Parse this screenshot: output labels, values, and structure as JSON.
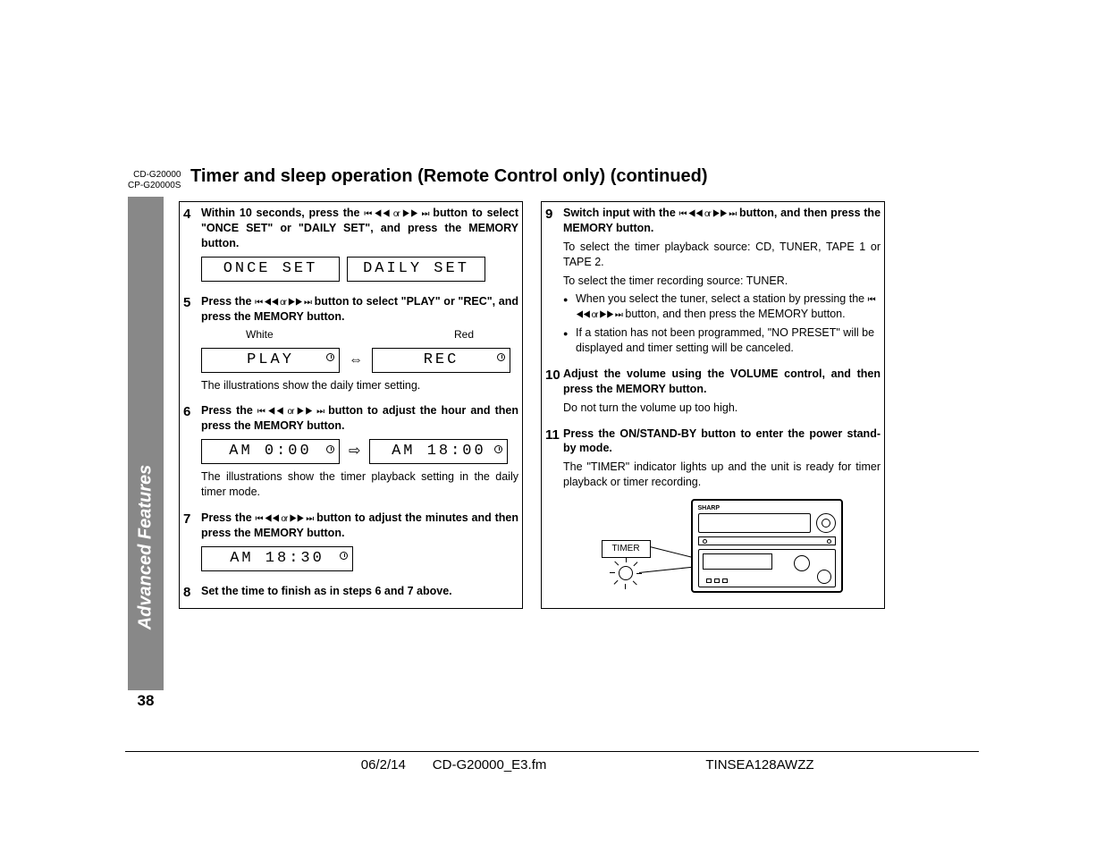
{
  "header": {
    "model1": "CD-G20000",
    "model2": "CP-G20000S",
    "title": "Timer and sleep operation (Remote Control only) (continued)"
  },
  "sidebar": {
    "section_label": "Advanced Features",
    "page_number": "38"
  },
  "icons": {
    "skip": "⏮ ◀◀ or ▶▶ ⏭"
  },
  "left_steps": {
    "s4": {
      "num": "4",
      "instruction_a": "Within 10 seconds, press the ",
      "instruction_b": " button to select \"ONCE SET\" or \"DAILY SET\", and press the MEMORY button.",
      "lcd1": "ONCE  SET",
      "lcd2": "DAILY SET"
    },
    "s5": {
      "num": "5",
      "instruction_a": "Press the ",
      "instruction_b": " button to select \"PLAY\" or \"REC\", and press the MEMORY button.",
      "label_white": "White",
      "label_red": "Red",
      "lcd1": "PLAY",
      "lcd2": "REC",
      "note": "The illustrations show the daily timer setting."
    },
    "s6": {
      "num": "6",
      "instruction_a": "Press the ",
      "instruction_b": " button to adjust the hour and then press the MEMORY button.",
      "lcd1": "AM  0:00",
      "lcd2": "AM  18:00",
      "note": "The illustrations show the timer playback setting in the daily timer mode."
    },
    "s7": {
      "num": "7",
      "instruction_a": "Press the ",
      "instruction_b": " button to adjust the minutes and then press the MEMORY button.",
      "lcd1": "AM  18:30"
    },
    "s8": {
      "num": "8",
      "instruction": "Set the time to finish as in steps 6 and 7 above."
    }
  },
  "right_steps": {
    "s9": {
      "num": "9",
      "instruction_a": "Switch input with the ",
      "instruction_b": " button, and then press the MEMORY button.",
      "note1": "To select the timer playback source: CD, TUNER, TAPE 1 or TAPE 2.",
      "note2": "To select the timer recording source: TUNER.",
      "bullet1_a": "When you select the tuner, select a station by pressing the ",
      "bullet1_b": " button, and then press the MEMORY button.",
      "bullet2": "If a station has not been programmed, \"NO PRESET\" will be displayed and timer setting will be canceled."
    },
    "s10": {
      "num": "10",
      "instruction": "Adjust the volume using the VOLUME control, and then press the MEMORY button.",
      "note": "Do not turn the volume up too high."
    },
    "s11": {
      "num": "11",
      "instruction": "Press the ON/STAND-BY button to enter the power stand-by mode.",
      "note": "The \"TIMER\" indicator lights up and the unit is ready for timer playback or timer recording.",
      "callout": "TIMER",
      "brand": "SHARP"
    }
  },
  "footer": {
    "date": "06/2/14",
    "file": "CD-G20000_E3.fm",
    "code": "TINSEA128AWZZ"
  }
}
